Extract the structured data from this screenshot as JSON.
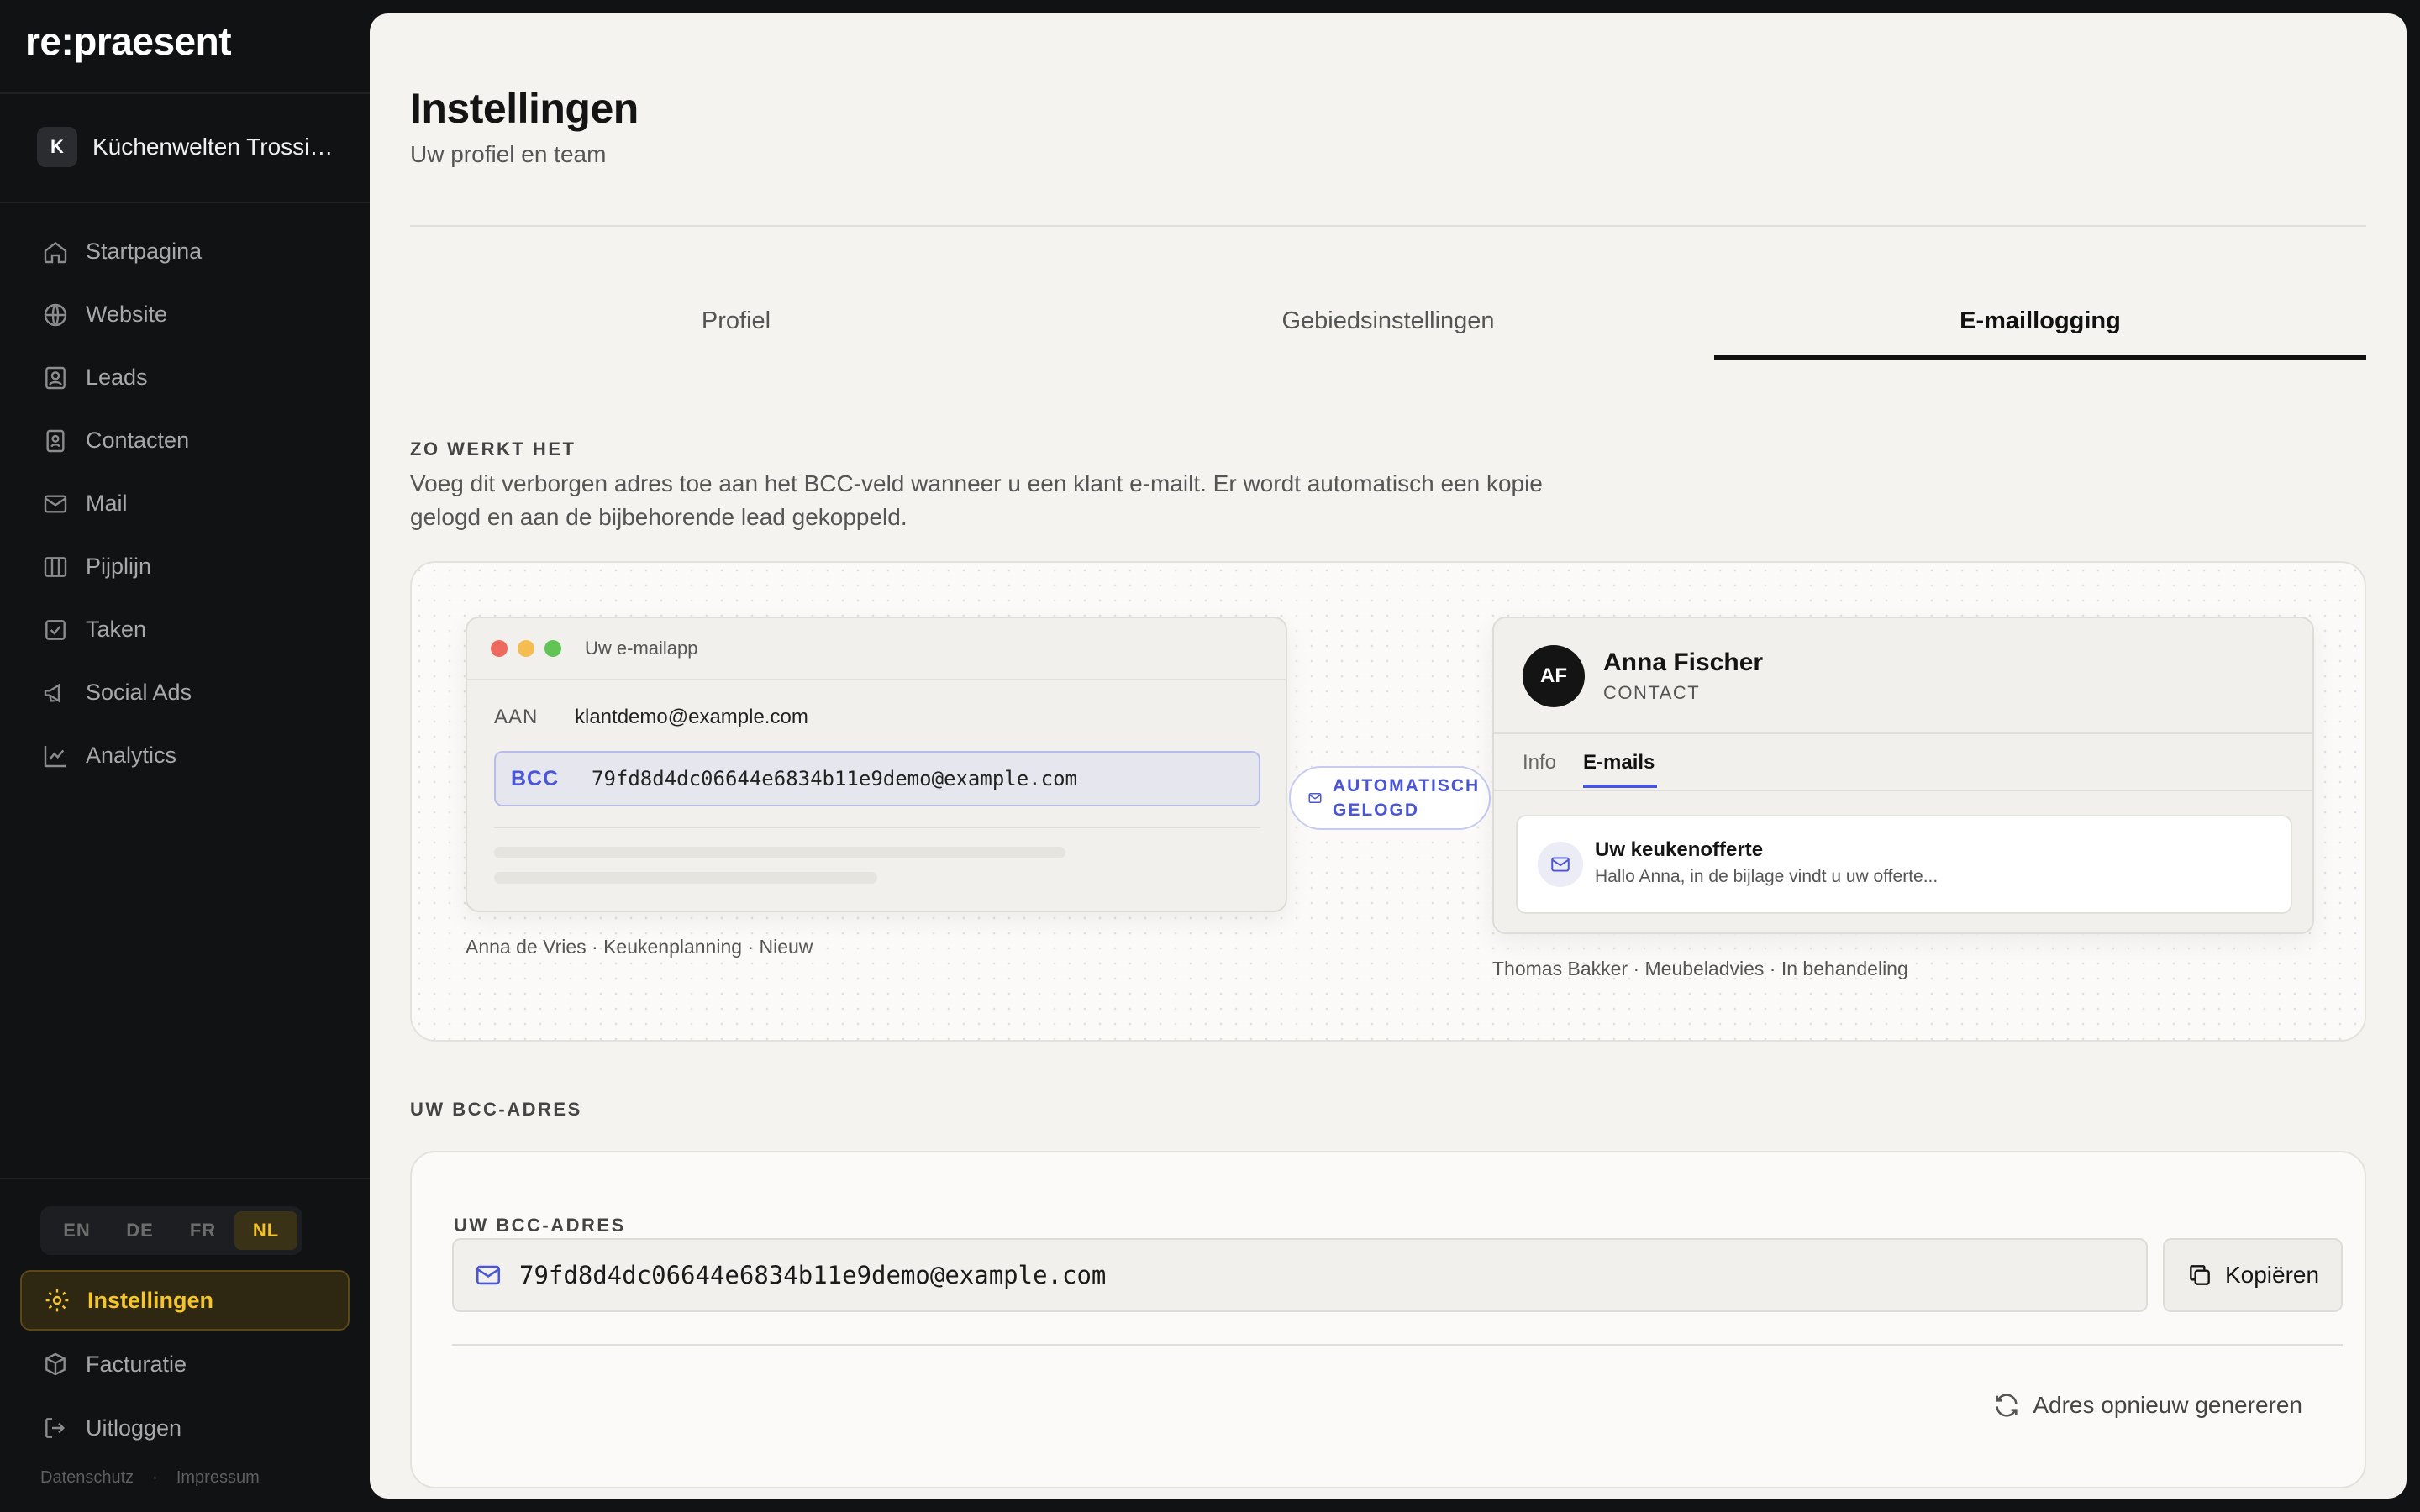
{
  "app": {
    "brand": "re:praesent"
  },
  "workspace": {
    "initial": "K",
    "name": "Küchenwelten Trossingen"
  },
  "nav": {
    "items": [
      {
        "label": "Startpagina",
        "icon": "home-icon"
      },
      {
        "label": "Website",
        "icon": "globe-icon"
      },
      {
        "label": "Leads",
        "icon": "contact-card-icon"
      },
      {
        "label": "Contacten",
        "icon": "address-book-icon"
      },
      {
        "label": "Mail",
        "icon": "mail-icon"
      },
      {
        "label": "Pijplijn",
        "icon": "columns-icon"
      },
      {
        "label": "Taken",
        "icon": "checkbox-icon"
      },
      {
        "label": "Social Ads",
        "icon": "megaphone-icon"
      },
      {
        "label": "Analytics",
        "icon": "line-chart-icon"
      }
    ]
  },
  "languages": {
    "options": [
      "EN",
      "DE",
      "FR",
      "NL"
    ],
    "selected": "NL"
  },
  "bottom_nav": {
    "settings": "Instellingen",
    "billing": "Facturatie",
    "logout": "Uitloggen"
  },
  "footer": {
    "privacy": "Datenschutz",
    "imprint": "Impressum"
  },
  "page": {
    "title": "Instellingen",
    "subtitle": "Uw profiel en team"
  },
  "tabs": {
    "items": [
      "Profiel",
      "Gebiedsinstellingen",
      "E-maillogging"
    ],
    "active": "E-maillogging"
  },
  "how_it_works": {
    "label": "ZO WERKT HET",
    "text": "Voeg dit verborgen adres toe aan het BCC-veld wanneer u een klant e-mailt. Er wordt automatisch een kopie gelogd en aan de bijbehorende lead gekoppeld."
  },
  "demo": {
    "mail_app": {
      "title": "Uw e-mailapp",
      "to_label": "AAN",
      "to_value": "klantdemo@example.com",
      "bcc_label": "BCC",
      "bcc_value": "79fd8d4dc06644e6834b11e9demo@example.com"
    },
    "left_caption": "Anna de Vries · Keukenplanning · Nieuw",
    "pill": {
      "line1": "AUTOMATISCH",
      "line2": "GELOGD"
    },
    "crm": {
      "initials": "AF",
      "name": "Anna Fischer",
      "role": "CONTACT",
      "tab_info": "Info",
      "tab_emails": "E-mails",
      "mail_subject": "Uw keukenofferte",
      "mail_preview": "Hallo Anna, in de bijlage vindt u uw offerte..."
    },
    "right_caption": "Thomas Bakker · Meubeladvies · In behandeling"
  },
  "bcc_section": {
    "label": "UW BCC-ADRES",
    "field_label": "UW BCC-ADRES",
    "address": "79fd8d4dc06644e6834b11e9demo@example.com",
    "copy_label": "Kopiëren",
    "regenerate_label": "Adres opnieuw genereren"
  },
  "colors": {
    "accent": "#4a56d6",
    "active_nav": "#f5c52a",
    "sidebar_bg": "#111214",
    "panel_bg": "#f4f3ef"
  }
}
